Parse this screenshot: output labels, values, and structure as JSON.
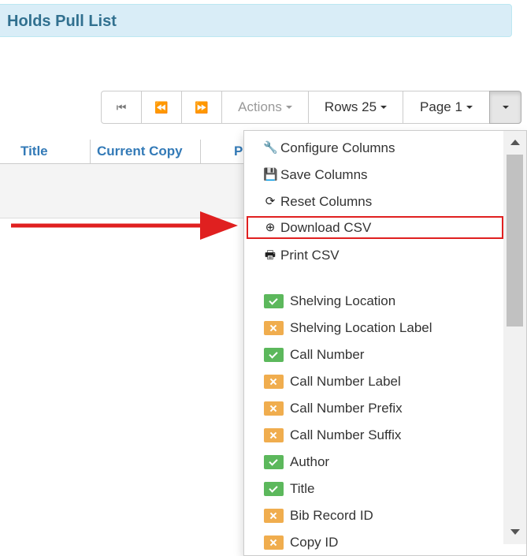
{
  "page": {
    "title": "Holds Pull List"
  },
  "toolbar": {
    "first_page_glyph": "⏮",
    "prev_page_glyph": "⏪",
    "next_page_glyph": "⏩",
    "actions_label": "Actions",
    "rows_label": "Rows 25",
    "page_label": "Page 1"
  },
  "grid": {
    "columns": [
      "Title",
      "Current Copy",
      "P"
    ]
  },
  "menu": {
    "items": [
      {
        "label": "Configure Columns",
        "icon": "wrench-icon",
        "glyph": "🔧"
      },
      {
        "label": "Save Columns",
        "icon": "save-icon",
        "glyph": "💾"
      },
      {
        "label": "Reset Columns",
        "icon": "refresh-icon",
        "glyph": "⟳"
      },
      {
        "label": "Download CSV",
        "icon": "download-icon",
        "glyph": "⊕"
      },
      {
        "label": "Print CSV",
        "icon": "print-icon",
        "glyph": "🖶"
      }
    ],
    "highlighted_item": "Download CSV",
    "columns": [
      {
        "label": "Shelving Location",
        "visible": true
      },
      {
        "label": "Shelving Location Label",
        "visible": false
      },
      {
        "label": "Call Number",
        "visible": true
      },
      {
        "label": "Call Number Label",
        "visible": false
      },
      {
        "label": "Call Number Prefix",
        "visible": false
      },
      {
        "label": "Call Number Suffix",
        "visible": false
      },
      {
        "label": "Author",
        "visible": true
      },
      {
        "label": "Title",
        "visible": true
      },
      {
        "label": "Bib Record ID",
        "visible": false
      },
      {
        "label": "Copy ID",
        "visible": false
      }
    ]
  },
  "colors": {
    "annotation_red": "#e02020",
    "visible_green": "#5cb85c",
    "hidden_orange": "#f0ad4e",
    "title_blue": "#31708f"
  }
}
